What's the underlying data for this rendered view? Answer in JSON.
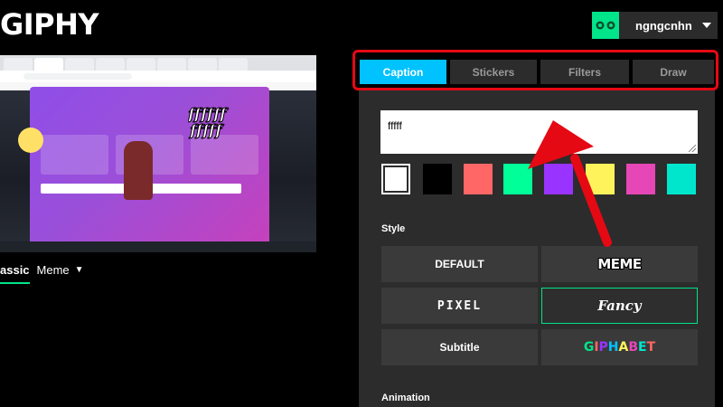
{
  "app": {
    "logo": "GIPHY"
  },
  "user": {
    "name": "ngngcnhn"
  },
  "preview": {
    "style_tabs": [
      {
        "label": "assic",
        "active": true
      },
      {
        "label": "Meme",
        "active": false
      }
    ]
  },
  "tabs": [
    {
      "label": "Caption",
      "active": true
    },
    {
      "label": "Stickers",
      "active": false
    },
    {
      "label": "Filters",
      "active": false
    },
    {
      "label": "Draw",
      "active": false
    }
  ],
  "caption": {
    "value": "fffff"
  },
  "colors": [
    {
      "name": "white",
      "hex": "#ffffff",
      "selected": true
    },
    {
      "name": "black",
      "hex": "#000000",
      "selected": false
    },
    {
      "name": "red",
      "hex": "#ff6666",
      "selected": false
    },
    {
      "name": "green",
      "hex": "#00ff99",
      "selected": false
    },
    {
      "name": "purple",
      "hex": "#9933ff",
      "selected": false
    },
    {
      "name": "yellow",
      "hex": "#fff35c",
      "selected": false
    },
    {
      "name": "pink",
      "hex": "#e646b6",
      "selected": false
    },
    {
      "name": "teal",
      "hex": "#00e6cc",
      "selected": false
    }
  ],
  "style": {
    "heading": "Style",
    "options": [
      {
        "label": "DEFAULT",
        "selected": false
      },
      {
        "label": "MEME",
        "selected": false
      },
      {
        "label": "PIXEL",
        "selected": false
      },
      {
        "label": "Fancy",
        "selected": true
      },
      {
        "label": "Subtitle",
        "selected": false
      },
      {
        "label": "GIPHABET",
        "selected": false
      }
    ]
  },
  "animation": {
    "heading": "Animation"
  },
  "theme": {
    "accent": "#00c2ff",
    "brand_green": "#00e58a",
    "annotation_red": "#e50914"
  }
}
